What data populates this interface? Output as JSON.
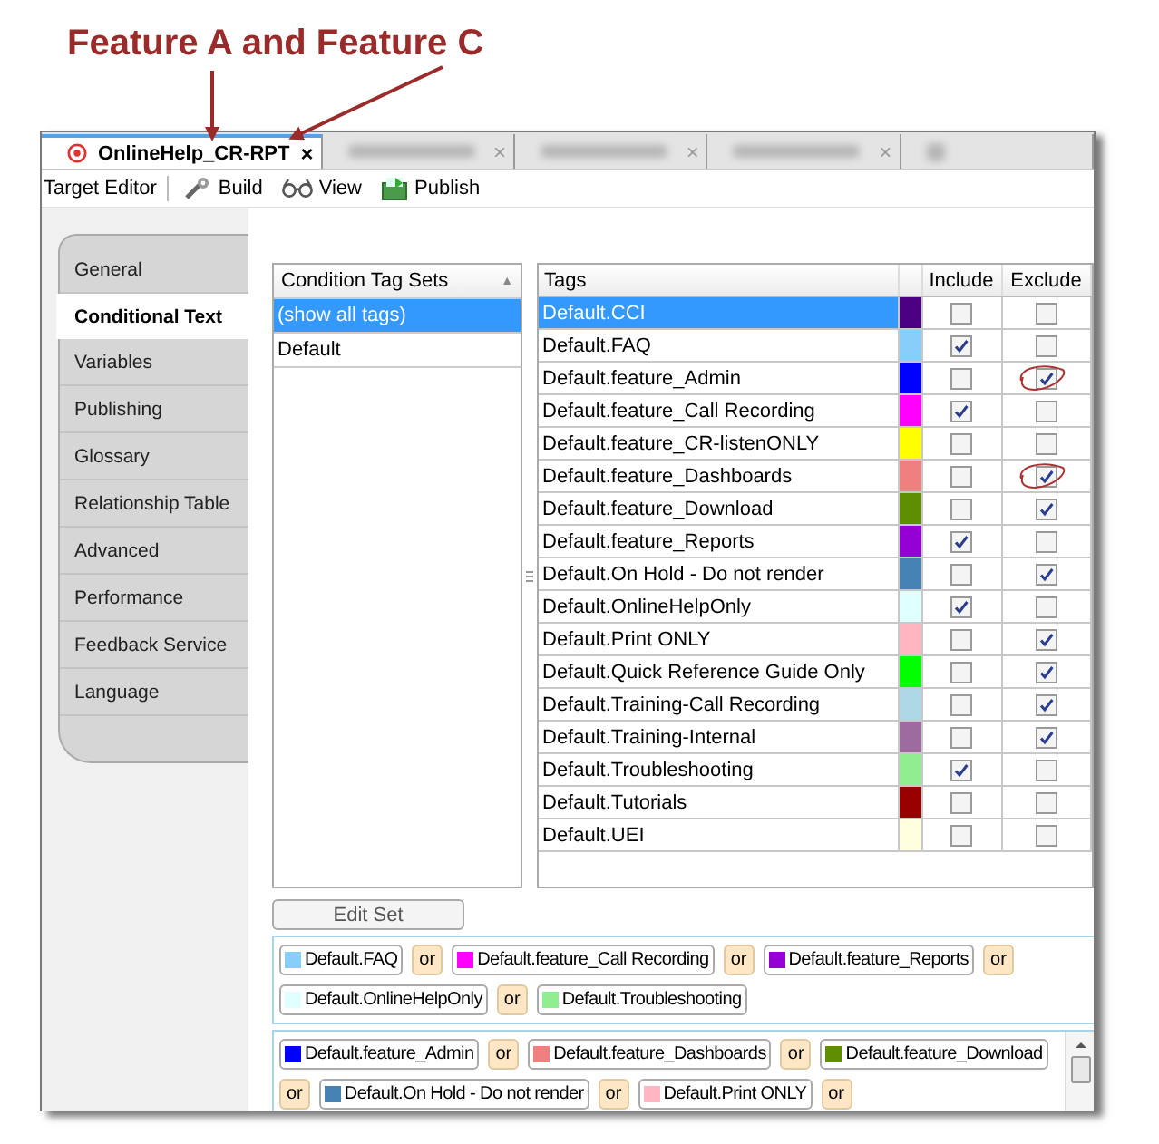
{
  "annotation": {
    "title": "Feature A and Feature C"
  },
  "tabs": [
    {
      "label": "OnlineHelp_CR-RPT",
      "close": "×",
      "selected": true
    },
    {
      "close": "×",
      "selected": false
    },
    {
      "close": "×",
      "selected": false
    },
    {
      "close": "×",
      "selected": false
    },
    {
      "selected": false
    }
  ],
  "toolbar": {
    "title": "Target Editor",
    "buttons": [
      "Build",
      "View",
      "Publish"
    ]
  },
  "sidebar": {
    "items": [
      {
        "label": "General",
        "selected": false
      },
      {
        "label": "Conditional Text",
        "selected": true
      },
      {
        "label": "Variables",
        "selected": false
      },
      {
        "label": "Publishing",
        "selected": false
      },
      {
        "label": "Glossary",
        "selected": false
      },
      {
        "label": "Relationship Table",
        "selected": false
      },
      {
        "label": "Advanced",
        "selected": false
      },
      {
        "label": "Performance",
        "selected": false
      },
      {
        "label": "Feedback Service",
        "selected": false
      },
      {
        "label": "Language",
        "selected": false
      }
    ]
  },
  "tag_sets": {
    "header": "Condition Tag Sets",
    "sort_arrow": "▲",
    "items": [
      {
        "label": "(show all tags)",
        "selected": true
      },
      {
        "label": "Default",
        "selected": false
      }
    ]
  },
  "tags": {
    "columns": [
      "Tags",
      "Include",
      "Exclude"
    ],
    "rows": [
      {
        "name": "Default.CCI",
        "color": "#4b0082",
        "include": false,
        "exclude": false,
        "circled": false,
        "selected": true
      },
      {
        "name": "Default.FAQ",
        "color": "#87cefa",
        "include": true,
        "exclude": false,
        "circled": false,
        "selected": false
      },
      {
        "name": "Default.feature_Admin",
        "color": "#0000ff",
        "include": false,
        "exclude": true,
        "circled": true,
        "selected": false
      },
      {
        "name": "Default.feature_Call Recording",
        "color": "#ff00ff",
        "include": true,
        "exclude": false,
        "circled": false,
        "selected": false
      },
      {
        "name": "Default.feature_CR-listenONLY",
        "color": "#ffff00",
        "include": false,
        "exclude": false,
        "circled": false,
        "selected": false
      },
      {
        "name": "Default.feature_Dashboards",
        "color": "#f08080",
        "include": false,
        "exclude": true,
        "circled": true,
        "selected": false
      },
      {
        "name": "Default.feature_Download",
        "color": "#5f8f00",
        "include": false,
        "exclude": true,
        "circled": false,
        "selected": false
      },
      {
        "name": "Default.feature_Reports",
        "color": "#9400d3",
        "include": true,
        "exclude": false,
        "circled": false,
        "selected": false
      },
      {
        "name": "Default.On Hold - Do not render",
        "color": "#4682b4",
        "include": false,
        "exclude": true,
        "circled": false,
        "selected": false
      },
      {
        "name": "Default.OnlineHelpOnly",
        "color": "#e0ffff",
        "include": true,
        "exclude": false,
        "circled": false,
        "selected": false
      },
      {
        "name": "Default.Print ONLY",
        "color": "#ffb6c1",
        "include": false,
        "exclude": true,
        "circled": false,
        "selected": false
      },
      {
        "name": "Default.Quick Reference Guide Only",
        "color": "#00ff00",
        "include": false,
        "exclude": true,
        "circled": false,
        "selected": false
      },
      {
        "name": "Default.Training-Call Recording",
        "color": "#add8e6",
        "include": false,
        "exclude": true,
        "circled": false,
        "selected": false
      },
      {
        "name": "Default.Training-Internal",
        "color": "#9e6b9e",
        "include": false,
        "exclude": true,
        "circled": false,
        "selected": false
      },
      {
        "name": "Default.Troubleshooting",
        "color": "#90ee90",
        "include": true,
        "exclude": false,
        "circled": false,
        "selected": false
      },
      {
        "name": "Default.Tutorials",
        "color": "#990000",
        "include": false,
        "exclude": false,
        "circled": false,
        "selected": false
      },
      {
        "name": "Default.UEI",
        "color": "#ffffe0",
        "include": false,
        "exclude": false,
        "circled": false,
        "selected": false
      }
    ]
  },
  "edit_button": "Edit Set",
  "expressions": [
    {
      "lines": [
        [
          {
            "kind": "tag",
            "label": "Default.FAQ",
            "color": "#87cefa"
          },
          {
            "kind": "or",
            "label": "or"
          },
          {
            "kind": "tag",
            "label": "Default.feature_Call Recording",
            "color": "#ff00ff"
          },
          {
            "kind": "or",
            "label": "or"
          },
          {
            "kind": "tag",
            "label": "Default.feature_Reports",
            "color": "#9400d3"
          },
          {
            "kind": "or",
            "label": "or"
          }
        ],
        [
          {
            "kind": "tag",
            "label": "Default.OnlineHelpOnly",
            "color": "#e0ffff"
          },
          {
            "kind": "or",
            "label": "or"
          },
          {
            "kind": "tag",
            "label": "Default.Troubleshooting",
            "color": "#90ee90"
          }
        ]
      ]
    },
    {
      "lines": [
        [
          {
            "kind": "tag",
            "label": "Default.feature_Admin",
            "color": "#0000ff"
          },
          {
            "kind": "or",
            "label": "or"
          },
          {
            "kind": "tag",
            "label": "Default.feature_Dashboards",
            "color": "#f08080"
          },
          {
            "kind": "or",
            "label": "or"
          },
          {
            "kind": "tag",
            "label": "Default.feature_Download",
            "color": "#5f8f00"
          }
        ],
        [
          {
            "kind": "or",
            "label": "or"
          },
          {
            "kind": "tag",
            "label": "Default.On Hold - Do not render",
            "color": "#4682b4"
          },
          {
            "kind": "or",
            "label": "or"
          },
          {
            "kind": "tag",
            "label": "Default.Print ONLY",
            "color": "#ffb6c1"
          },
          {
            "kind": "or",
            "label": "or"
          }
        ]
      ]
    }
  ]
}
